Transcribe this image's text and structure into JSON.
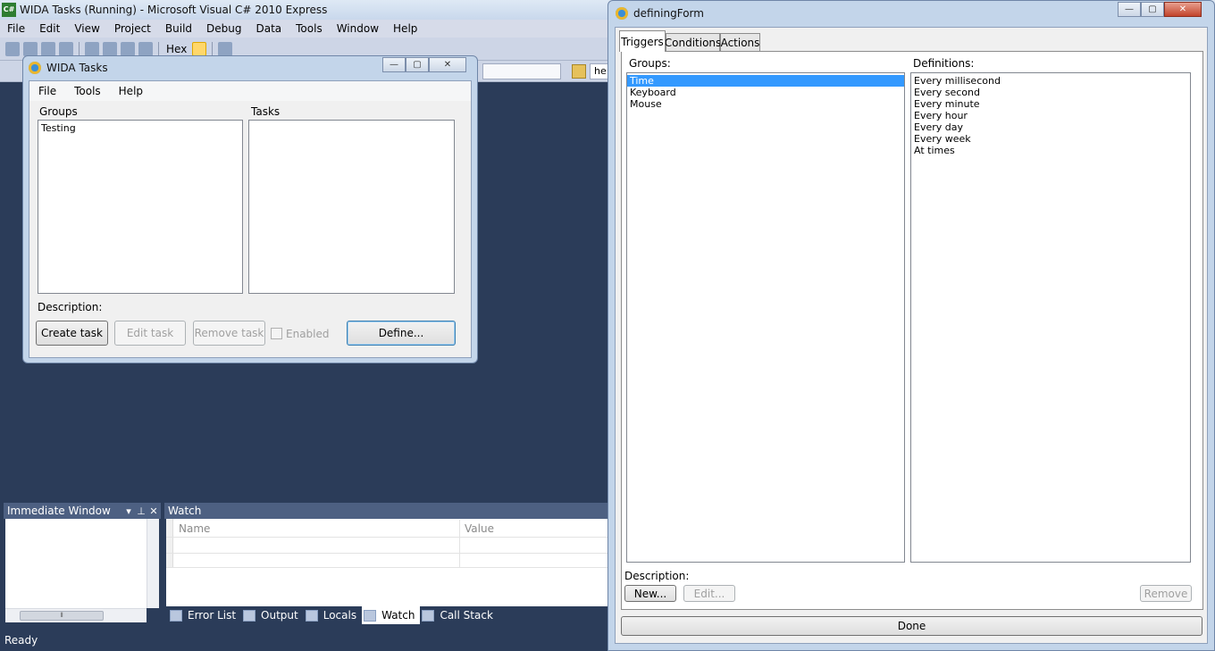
{
  "vs": {
    "title": "WIDA Tasks (Running) - Microsoft Visual C# 2010 Express",
    "app_icon": "C#",
    "menu": [
      "File",
      "Edit",
      "View",
      "Project",
      "Build",
      "Debug",
      "Data",
      "Tools",
      "Window",
      "Help"
    ],
    "toolbar": {
      "hex_label": "Hex",
      "find_text": "he"
    },
    "immediate": {
      "title": "Immediate Window",
      "dropdown": "▾",
      "pin": "⊥",
      "close": "✕"
    },
    "watch": {
      "title": "Watch",
      "col_name": "Name",
      "col_value": "Value"
    },
    "bottom_tabs": [
      "Error List",
      "Output",
      "Locals",
      "Watch",
      "Call Stack"
    ],
    "status": "Ready"
  },
  "wida": {
    "title": "WIDA Tasks",
    "menu": [
      "File",
      "Tools",
      "Help"
    ],
    "groups_label": "Groups",
    "tasks_label": "Tasks",
    "groups": [
      "Testing"
    ],
    "description_label": "Description:",
    "buttons": {
      "create": "Create task",
      "edit": "Edit task",
      "remove": "Remove task",
      "enabled": "Enabled",
      "define": "Define..."
    },
    "caption": {
      "minimize": "—",
      "maximize": "▢",
      "close": "✕"
    }
  },
  "def": {
    "title": "definingForm",
    "tabs": [
      "Triggers",
      "Conditions",
      "Actions"
    ],
    "groups_label": "Groups:",
    "definitions_label": "Definitions:",
    "groups": [
      "Time",
      "Keyboard",
      "Mouse"
    ],
    "selected_group": "Time",
    "definitions": [
      "Every millisecond",
      "Every second",
      "Every minute",
      "Every hour",
      "Every day",
      "Every week",
      "At times"
    ],
    "description_label": "Description:",
    "buttons": {
      "new": "New...",
      "edit": "Edit...",
      "remove": "Remove",
      "done": "Done"
    },
    "caption": {
      "minimize": "—",
      "maximize": "▢",
      "close": "✕"
    }
  }
}
